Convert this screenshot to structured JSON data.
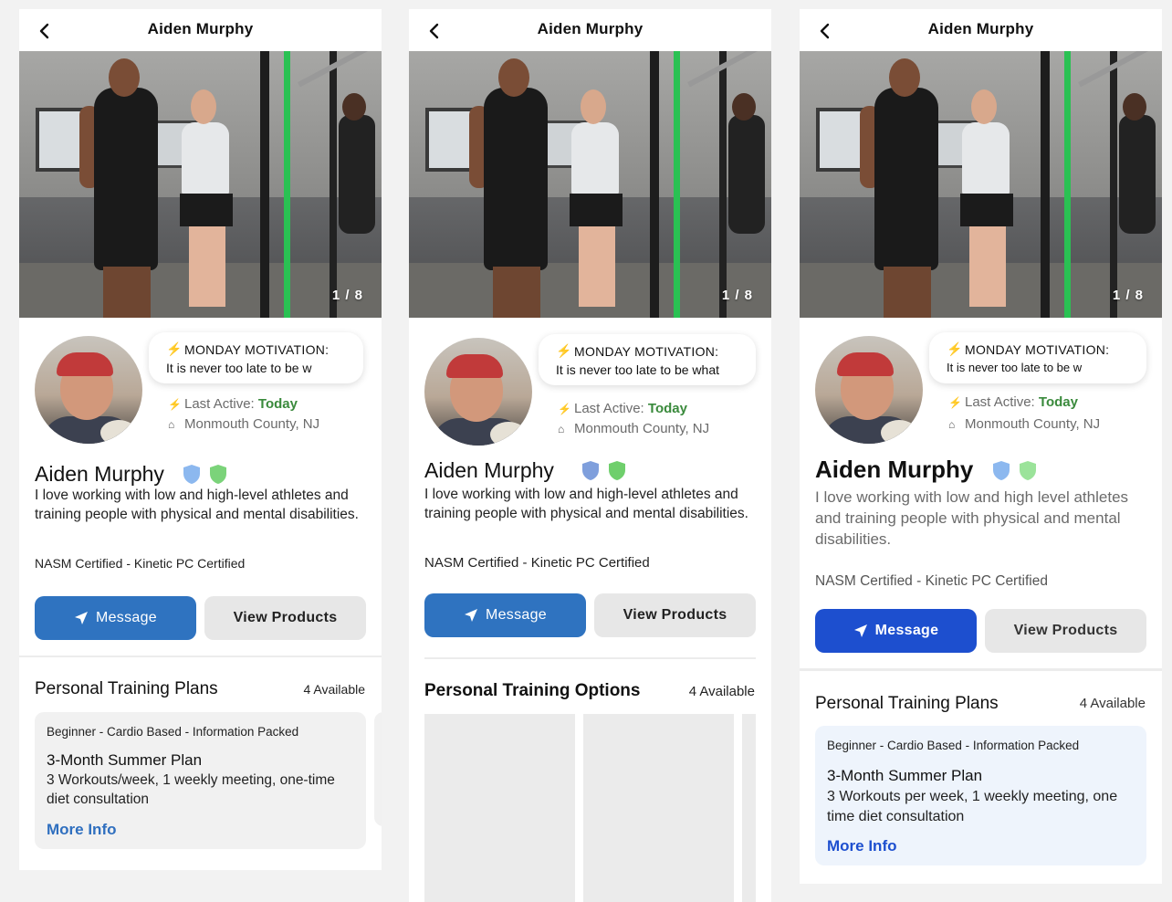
{
  "colors": {
    "primary_blue": "#2f73c0",
    "primary_blue_v3": "#1d4fcf",
    "active_green": "#3a8a3c",
    "shield_blue": "#8cb8ef",
    "shield_green": "#7bd37a"
  },
  "icons": {
    "back": "chevron-left-icon",
    "bolt": "lightning-bolt-icon",
    "home": "home-icon",
    "send": "send-arrow-icon",
    "shield": "shield-icon"
  },
  "panels": [
    {
      "header_title": "Aiden Murphy",
      "photo_counter": "1 / 8",
      "status_heading": "MONDAY MOTIVATION:",
      "status_message": "It is never too late to be w",
      "last_active_label": "Last Active:",
      "last_active_value": "Today",
      "location": "Monmouth County, NJ",
      "name": "Aiden Murphy",
      "bio": "I love working with low and high-level athletes and training people with physical and mental disabilities.",
      "certifications": "NASM Certified - Kinetic PC Certified",
      "message_button": "Message",
      "products_button": "View Products",
      "section_title": "Personal Training Plans",
      "section_count": "4 Available",
      "card": {
        "tags": "Beginner - Cardio Based - Information Packed",
        "title": "3-Month Summer Plan",
        "description": "3 Workouts/week, 1 weekly meeting, one-time diet consultation",
        "link": "More Info"
      }
    },
    {
      "header_title": "Aiden Murphy",
      "photo_counter": "1 / 8",
      "status_heading": "MONDAY MOTIVATION:",
      "status_message": "It is never too late to be what",
      "last_active_label": "Last Active:",
      "last_active_value": "Today",
      "location": "Monmouth County, NJ",
      "name": "Aiden Murphy",
      "bio": "I love working with low and high-level athletes and training people with physical and mental disabilities.",
      "certifications": "NASM Certified - Kinetic PC Certified",
      "message_button": "Message",
      "products_button": "View Products",
      "section_title": "Personal Training Options",
      "section_count": "4 Available"
    },
    {
      "header_title": "Aiden Murphy",
      "photo_counter": "1 / 8",
      "status_heading": "MONDAY MOTIVATION:",
      "status_message": "It is never too late to be w",
      "last_active_label": "Last Active:",
      "last_active_value": "Today",
      "location": "Monmouth County, NJ",
      "name": "Aiden Murphy",
      "bio": "I love working with low and high level athletes and training people with physical and mental disabilities.",
      "certifications": "NASM Certified - Kinetic PC Certified",
      "message_button": "Message",
      "products_button": "View Products",
      "section_title": "Personal Training Plans",
      "section_count": "4 Available",
      "card": {
        "tags": "Beginner - Cardio Based - Information Packed",
        "title": "3-Month Summer Plan",
        "description": "3 Workouts per week, 1 weekly meeting, one time diet consultation",
        "link": "More Info"
      }
    }
  ]
}
